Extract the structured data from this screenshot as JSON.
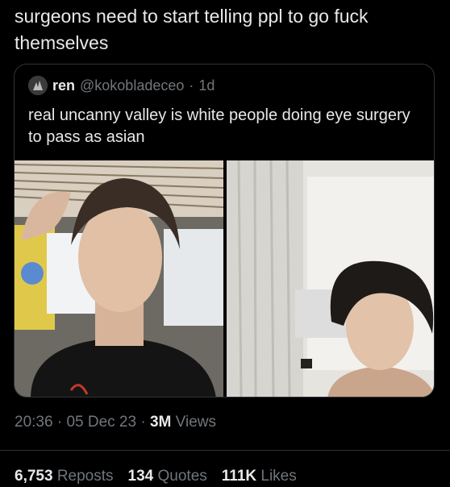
{
  "tweet": {
    "text": "surgeons need to start telling ppl to go fuck themselves"
  },
  "quote": {
    "name": "ren",
    "handle": "@kokobladeceo",
    "separator": "·",
    "time": "1d",
    "text": "real uncanny valley is white people doing eye surgery to pass as asian",
    "media": [
      {
        "alt": "person-selfie-left"
      },
      {
        "alt": "person-selfie-right"
      }
    ]
  },
  "meta": {
    "time": "20:36",
    "date": "05 Dec 23",
    "views": "3M",
    "views_label": "Views",
    "sep": "·"
  },
  "stats": {
    "reposts_count": "6,753",
    "reposts_label": "Reposts",
    "quotes_count": "134",
    "quotes_label": "Quotes",
    "likes_count": "111K",
    "likes_label": "Likes"
  }
}
